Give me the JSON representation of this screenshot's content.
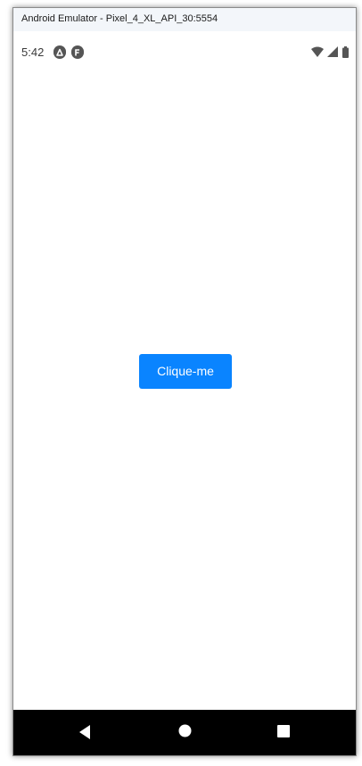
{
  "window": {
    "title": "Android Emulator - Pixel_4_XL_API_30:5554"
  },
  "status_bar": {
    "time": "5:42",
    "left_icons": [
      "app-notification-icon-a",
      "app-notification-icon-f"
    ],
    "right_icons": [
      "wifi-icon",
      "cell-signal-icon",
      "battery-icon"
    ]
  },
  "main": {
    "button_label": "Clique-me"
  },
  "nav_bar": {
    "items": [
      "back-icon",
      "home-icon",
      "recents-icon"
    ]
  },
  "colors": {
    "accent": "#0a84ff",
    "nav_bg": "#000000",
    "titlebar_bg": "#f3f6fa"
  }
}
